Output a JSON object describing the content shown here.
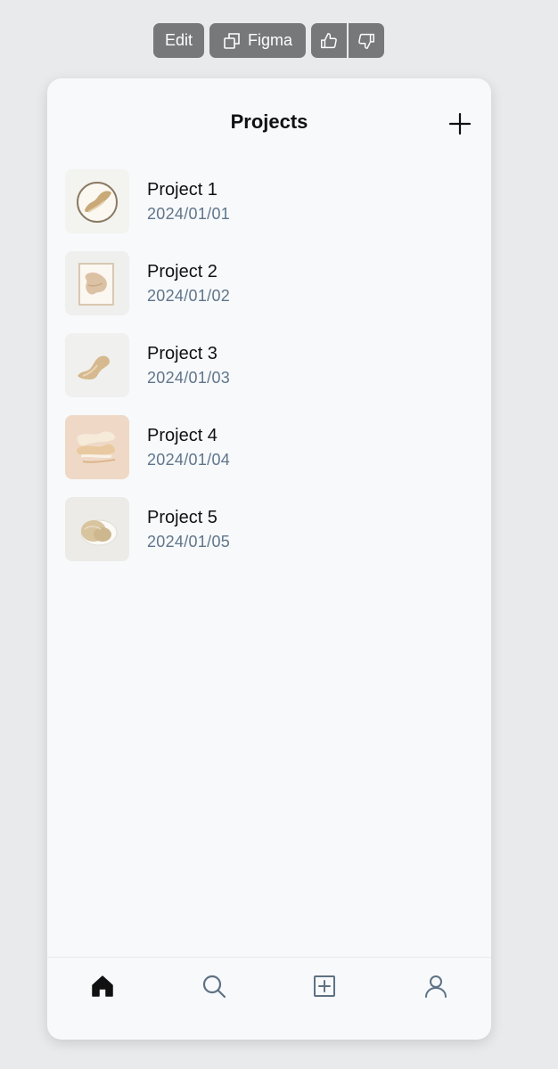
{
  "toolbar": {
    "edit_label": "Edit",
    "figma_label": "Figma",
    "icons": [
      "copy-icon",
      "thumbs-up-icon",
      "thumbs-down-icon"
    ]
  },
  "header": {
    "title": "Projects",
    "add_icon": "plus-icon"
  },
  "projects": [
    {
      "name": "Project 1",
      "date": "2024/01/01",
      "thumb_bg": "#f3f3ef"
    },
    {
      "name": "Project 2",
      "date": "2024/01/02",
      "thumb_bg": "#efefed"
    },
    {
      "name": "Project 3",
      "date": "2024/01/03",
      "thumb_bg": "#f0f0ee"
    },
    {
      "name": "Project 4",
      "date": "2024/01/04",
      "thumb_bg": "#efd9c6"
    },
    {
      "name": "Project 5",
      "date": "2024/01/05",
      "thumb_bg": "#ecebe8"
    }
  ],
  "tabbar": {
    "tabs": [
      {
        "icon": "home-icon",
        "active": true
      },
      {
        "icon": "search-icon",
        "active": false
      },
      {
        "icon": "plus-square-icon",
        "active": false
      },
      {
        "icon": "user-icon",
        "active": false
      }
    ]
  },
  "colors": {
    "page_bg": "#e9eaeb",
    "card_bg": "#f7f9fb",
    "toolbar_bg": "#77787a",
    "date_text": "#60758a",
    "icon_inactive": "#5f7184"
  }
}
